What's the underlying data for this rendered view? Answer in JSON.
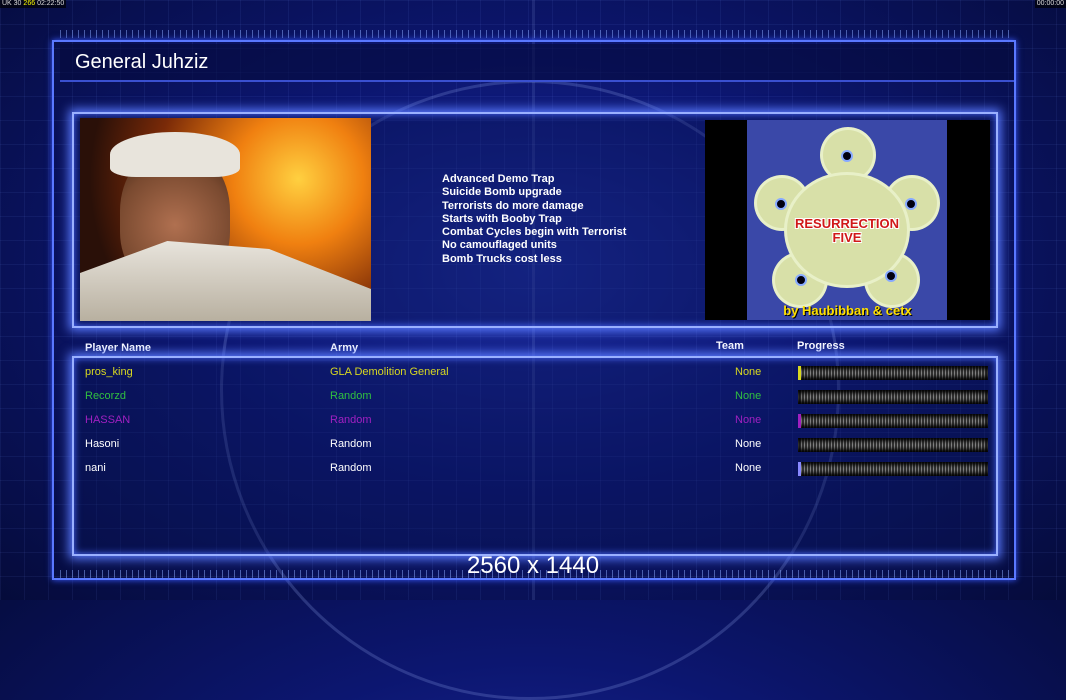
{
  "hud": {
    "left_prefix": "UK 30",
    "left_highlight": "266",
    "left_time": "02:22:50",
    "right_time": "00:00:00"
  },
  "title": "General Juhziz",
  "bonuses": [
    "Advanced Demo Trap",
    "Suicide Bomb upgrade",
    "Terrorists do more damage",
    "Starts with Booby Trap",
    "Combat Cycles begin with Terrorist",
    "No camouflaged units",
    "Bomb Trucks cost less"
  ],
  "map": {
    "name_line1": "RESURRECTION",
    "name_line2": "FIVE",
    "author": "by Haubibban & cetx"
  },
  "table": {
    "headers": {
      "player": "Player Name",
      "army": "Army",
      "team": "Team",
      "progress": "Progress"
    },
    "rows": [
      {
        "name": "pros_king",
        "army": "GLA Demolition General",
        "team": "None",
        "color": "#d8d820",
        "progress": 1
      },
      {
        "name": "Recorzd",
        "army": "Random",
        "team": "None",
        "color": "#30c040",
        "progress": 0
      },
      {
        "name": "HASSAN",
        "army": "Random",
        "team": "None",
        "color": "#a020c0",
        "progress": 1
      },
      {
        "name": "Hasoni",
        "army": "Random",
        "team": "None",
        "color": "#ffffff",
        "progress": 0
      },
      {
        "name": "nani",
        "army": "Random",
        "team": "None",
        "color": "#ffffff",
        "progress": 1
      }
    ]
  },
  "resolution": "2560 x 1440"
}
